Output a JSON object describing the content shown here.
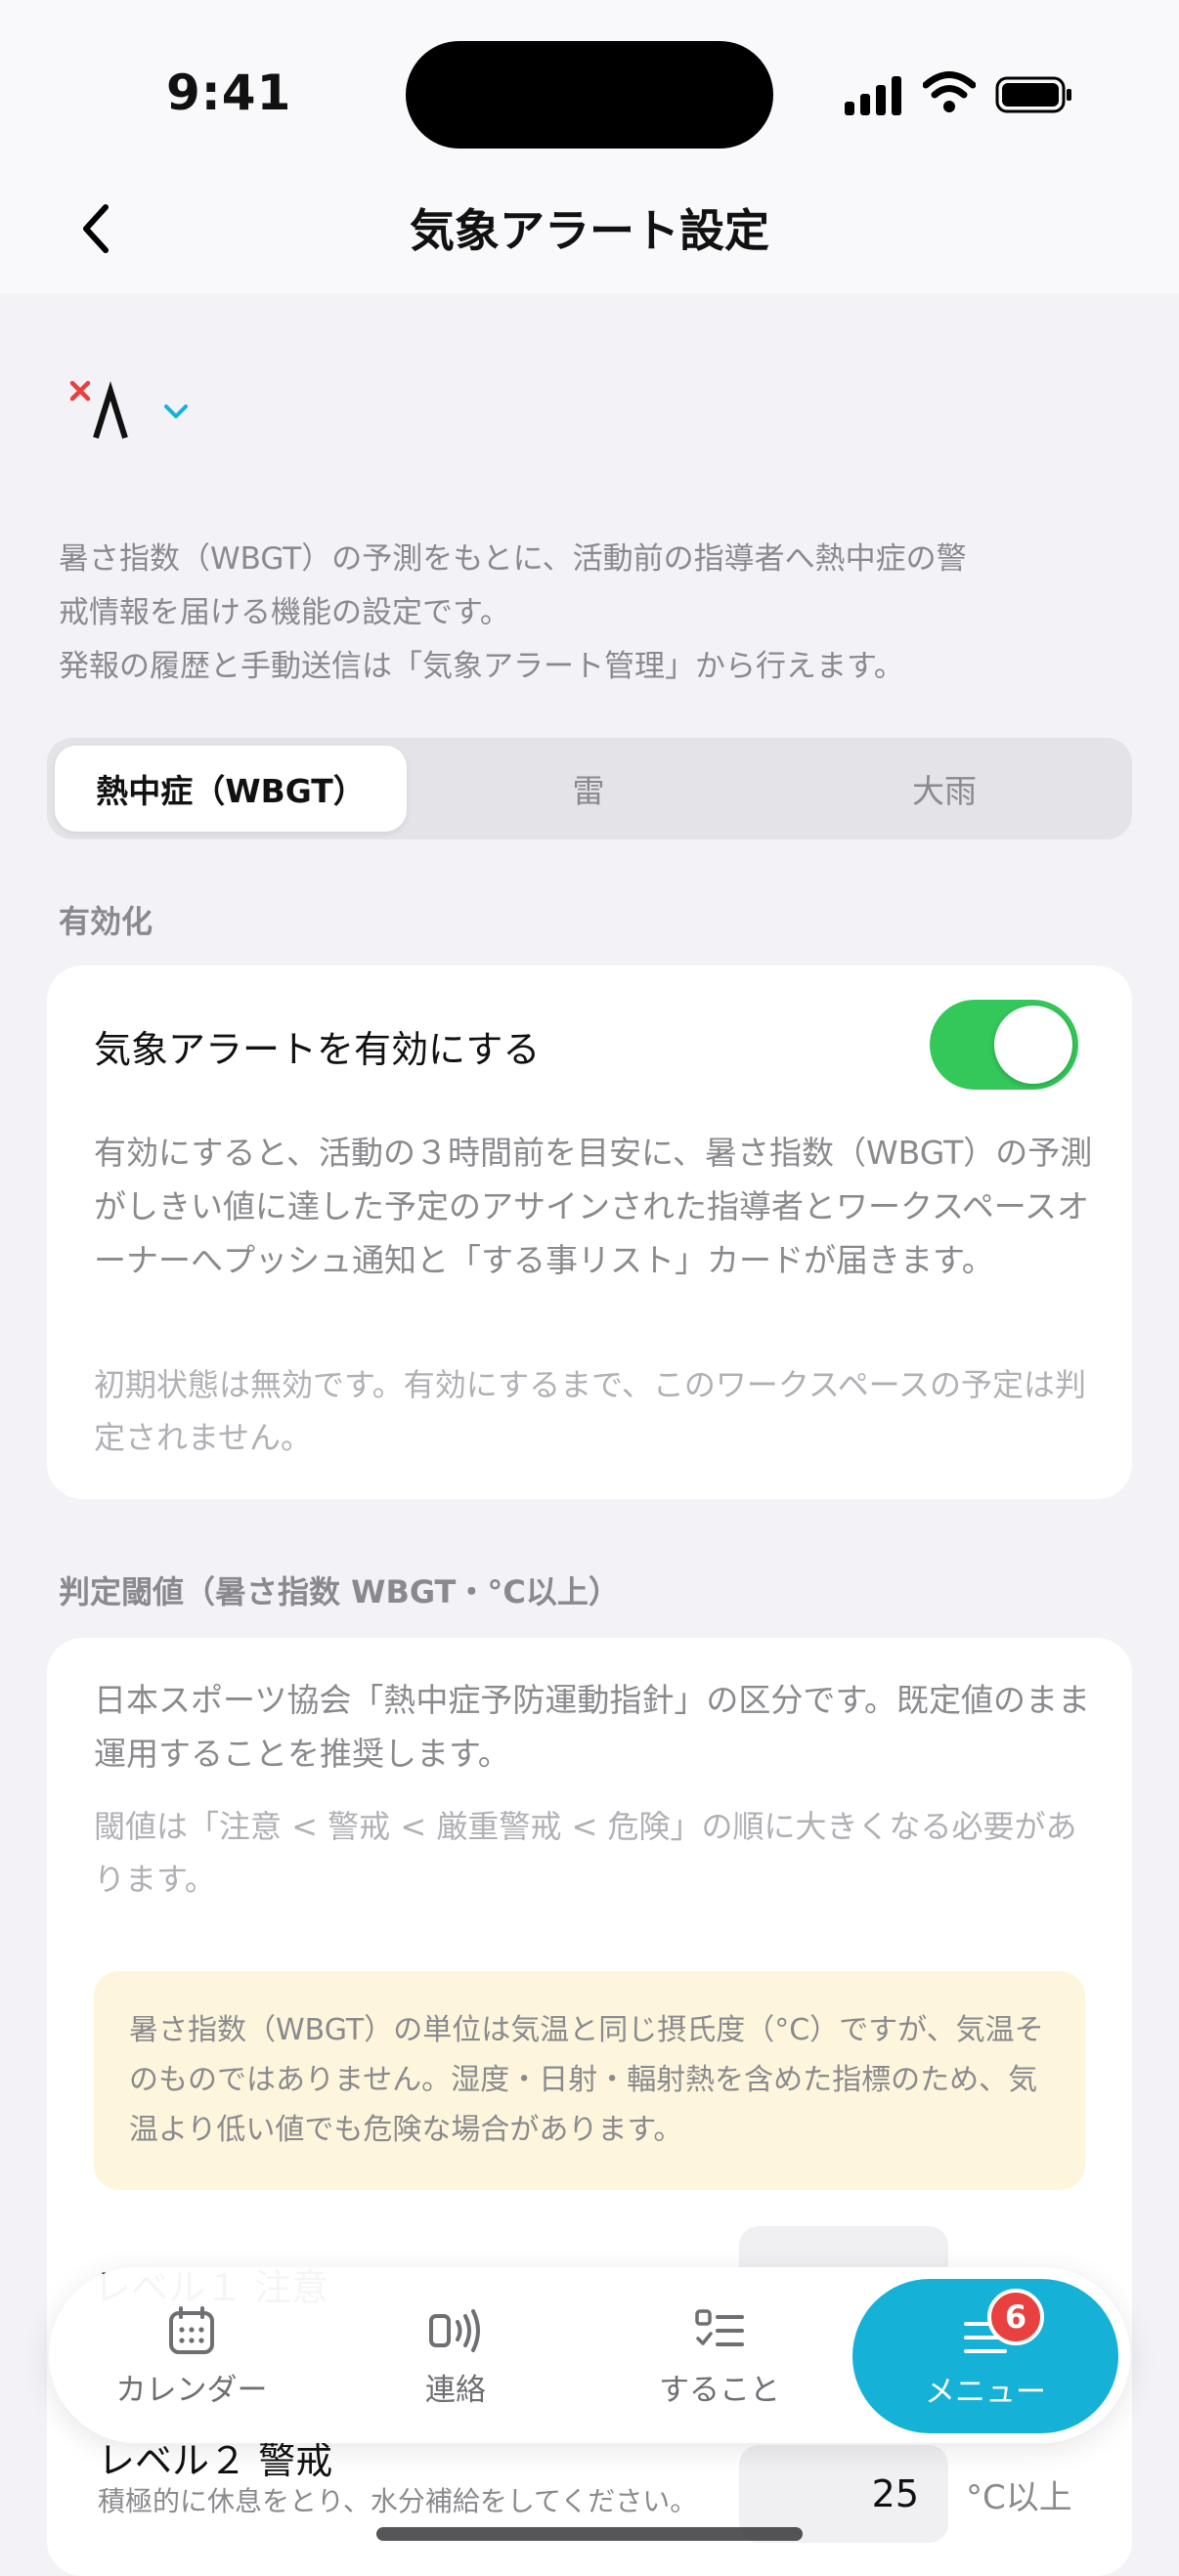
{
  "status": {
    "time": "9:41"
  },
  "header": {
    "title": "気象アラート設定"
  },
  "description": "暑さ指数（WBGT）の予測をもとに、活動前の指導者へ熱中症の警\n戒情報を届ける機能の設定です。\n発報の履歴と手動送信は「気象アラート管理」から行えます。",
  "tabs": [
    {
      "label": "熱中症（WBGT）",
      "active": true
    },
    {
      "label": "雷",
      "active": false
    },
    {
      "label": "大雨",
      "active": false
    }
  ],
  "enable_section": {
    "label": "有効化",
    "toggle_label": "気象アラートを有効にする",
    "toggle_on": true,
    "body1": "有効にすると、活動の３時間前を目安に、暑さ指数（WBGT）の予測がしきい値に達した予定のアサインされた指導者とワークスペースオーナーへプッシュ通知と「する事リスト」カードが届きます。",
    "body2": "初期状態は無効です。有効にするまで、このワークスペースの予定は判定されません。"
  },
  "threshold_section": {
    "label": "判定閾値（暑さ指数 WBGT・°C以上）",
    "body1": "日本スポーツ協会「熱中症予防運動指針」の区分です。既定値のまま運用することを推奨します。",
    "body2": "閾値は「注意 < 警戒 < 厳重警戒 < 危険」の順に大きくなる必要があります。",
    "notice": "暑さ指数（WBGT）の単位は気温と同じ摂氏度（°C）ですが、気温そのものではありません。湿度・日射・輻射熱を含めた指標のため、気温より低い値でも危険な場合があります。",
    "level1_title": "レベル１ 注意",
    "level2_title": "レベル２ 警戒",
    "level2_desc": "積極的に休息をとり、水分補給をしてください。",
    "level2_value": "25",
    "unit": "°C以上"
  },
  "tabbar": {
    "items": [
      {
        "label": "カレンダー",
        "icon": "calendar-icon"
      },
      {
        "label": "連絡",
        "icon": "broadcast-icon"
      },
      {
        "label": "すること",
        "icon": "checklist-icon"
      },
      {
        "label": "メニュー",
        "icon": "menu-icon"
      }
    ],
    "badge": "6"
  },
  "colors": {
    "accent": "#16b1d6",
    "toggle_on": "#34c759",
    "badge": "#e8413f",
    "notice_bg": "#fdf6dc"
  }
}
